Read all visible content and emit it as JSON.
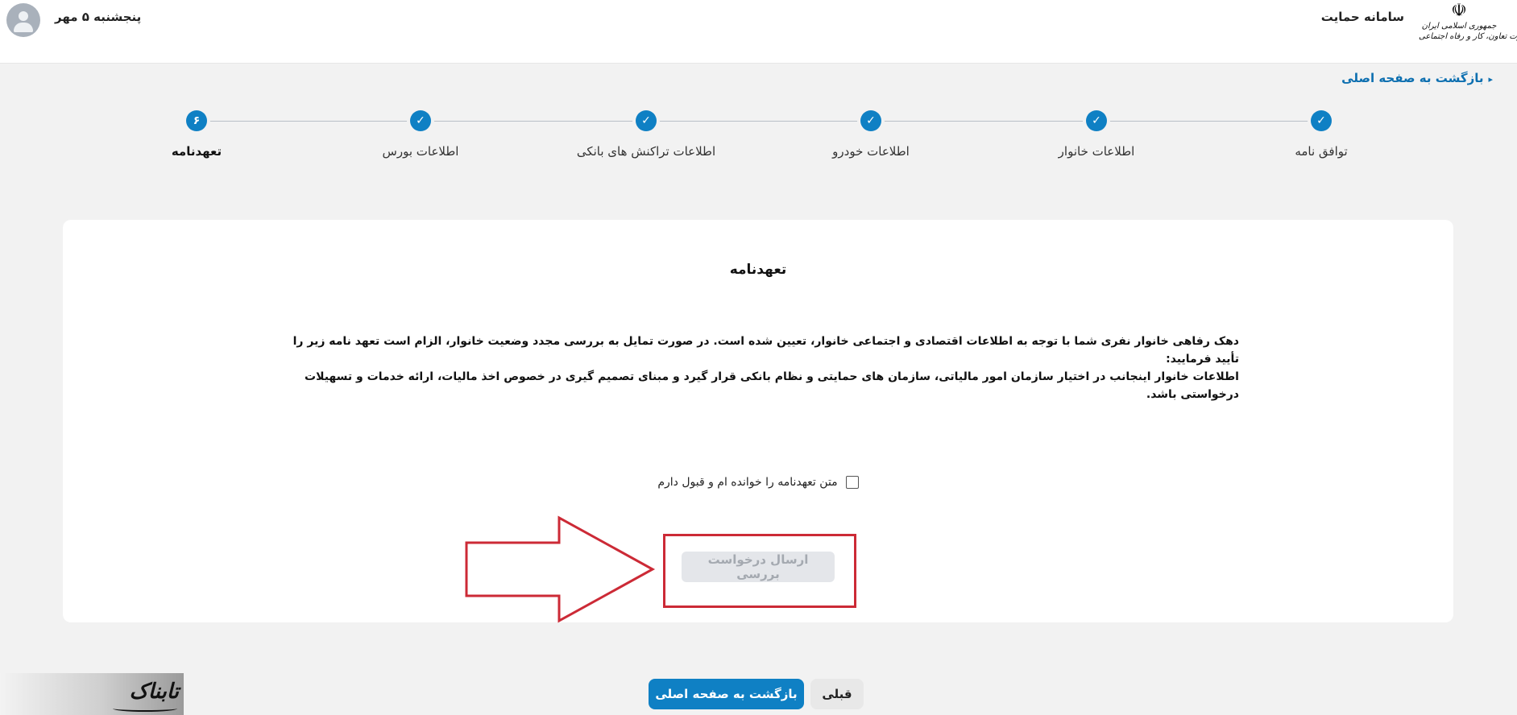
{
  "header": {
    "logo_lines": [
      "جمهوری اسلامی ایران",
      "وزارت تعاون، کار و رفاه اجتماعی"
    ],
    "system_name": "سامانه حمایت",
    "date": "پنجشنبه ۵ مهر"
  },
  "back_link": "بازگشت به صفحه اصلی",
  "steps": [
    {
      "label": "توافق نامه",
      "state": "done"
    },
    {
      "label": "اطلاعات خانوار",
      "state": "done"
    },
    {
      "label": "اطلاعات خودرو",
      "state": "done"
    },
    {
      "label": "اطلاعات تراکنش های بانکی",
      "state": "done"
    },
    {
      "label": "اطلاعات بورس",
      "state": "done"
    },
    {
      "label": "تعهدنامه",
      "state": "active",
      "number": "۶"
    }
  ],
  "card": {
    "title": "تعهدنامه",
    "body_line1": "دهک رفاهی خانوار نفری شما با توجه به اطلاعات اقتصادی و اجتماعی خانوار، تعیین شده است. در صورت تمایل به بررسی مجدد وضعیت خانوار، الزام است تعهد نامه زیر را تأیید فرمایید:",
    "body_line2": "اطلاعات خانوار اینجانب در اختیار سازمان امور مالیاتی، سازمان های حمایتی و نظام بانکی قرار گیرد و مبنای تصمیم گیری در خصوص اخذ مالیات، ارائه خدمات و تسهیلات درخواستی باشد.",
    "agree_label": "متن تعهدنامه را خوانده ام و قبول دارم",
    "agree_checked": false,
    "submit_label": "ارسال درخواست بررسی"
  },
  "footer": {
    "prev_label": "قبلی",
    "home_label": "بازگشت به صفحه اصلی"
  },
  "watermark": "تابناک",
  "colors": {
    "primary": "#0f80c4",
    "annotation_red": "#cc2a36",
    "disabled_bg": "#e4e6ea",
    "disabled_text": "#a4a9b0"
  }
}
